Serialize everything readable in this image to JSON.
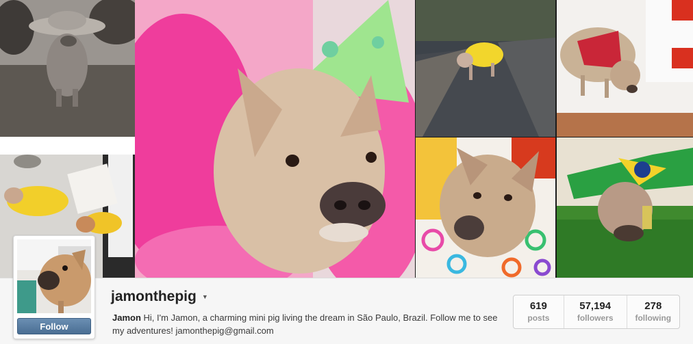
{
  "profile": {
    "username": "jamonthepig",
    "bio_name": "Jamon",
    "bio_text": "Hi, I'm Jamon, a charming mini pig living the dream in São Paulo, Brazil. Follow me to see my adventures! jamonthepig@gmail.com",
    "follow_label": "Follow",
    "menu_icon": "caret-down-icon"
  },
  "stats": [
    {
      "value": "619",
      "label": "posts"
    },
    {
      "value": "57,194",
      "label": "followers"
    },
    {
      "value": "278",
      "label": "following"
    }
  ],
  "colors": {
    "follow_button": "#527ba3",
    "party_tutu": "#f03fa0",
    "party_hat": "#8fe08a",
    "brazil_green": "#2a9a3a",
    "brazil_yellow": "#f5d020",
    "bandana_red": "#cc2233"
  }
}
